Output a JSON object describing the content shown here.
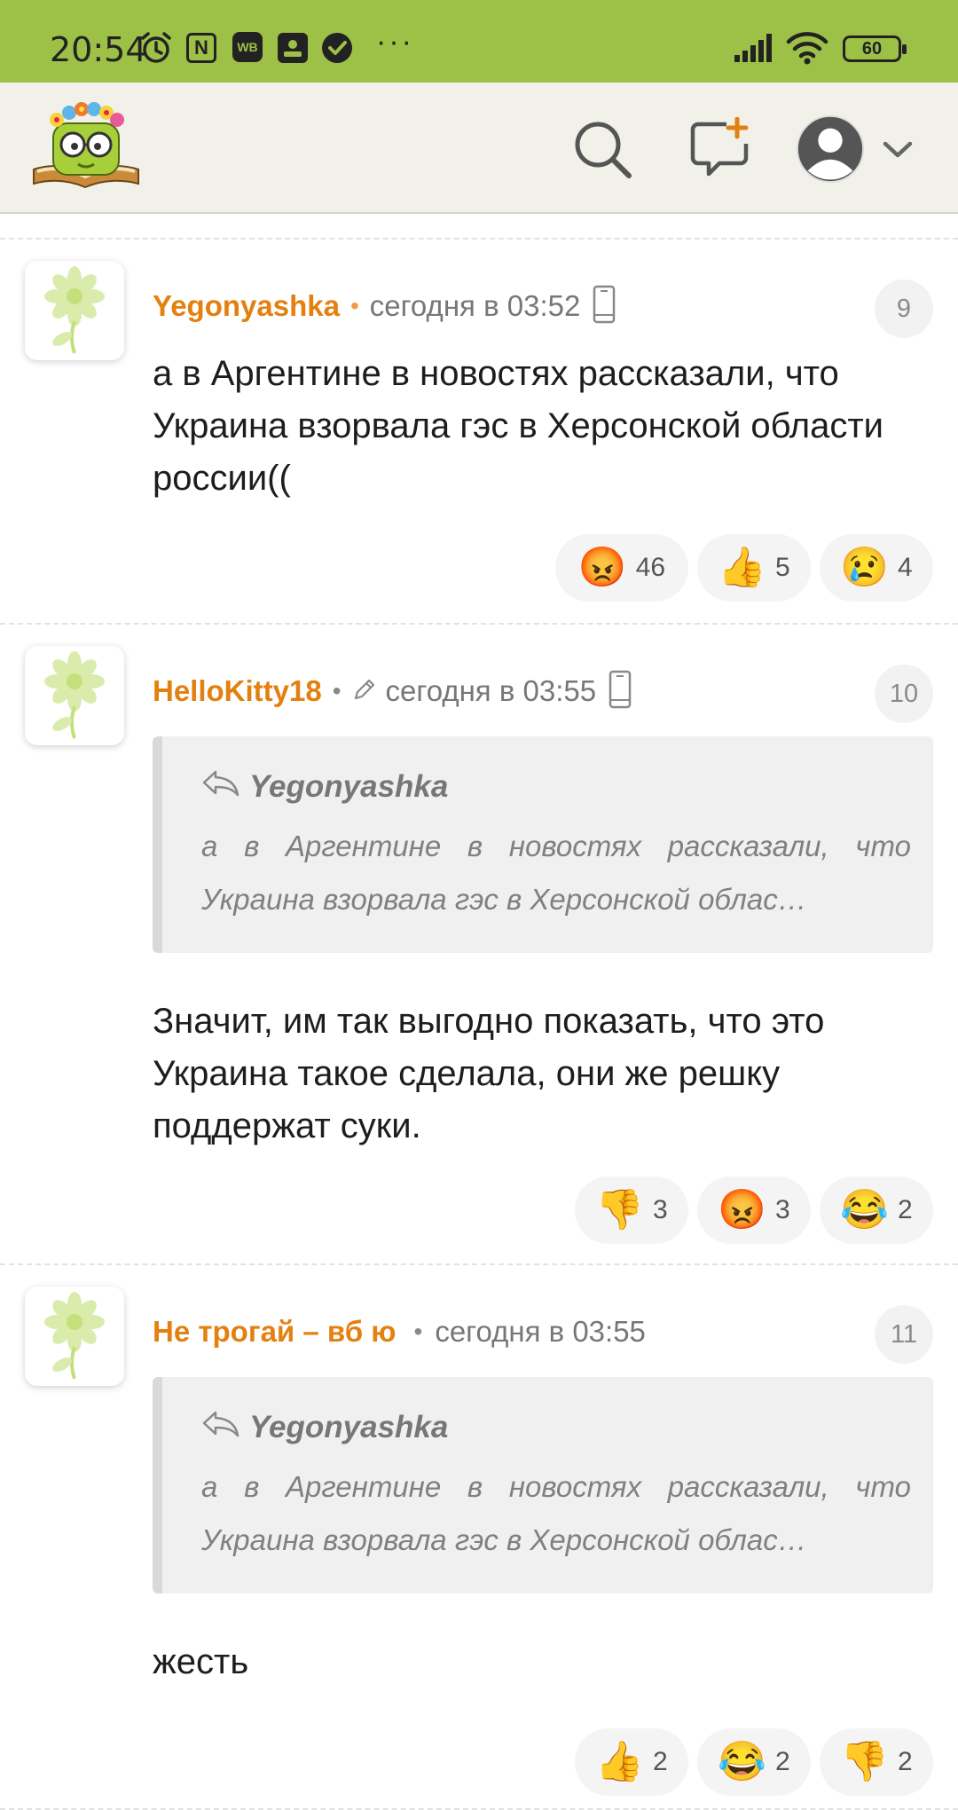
{
  "status_bar": {
    "time": "20:54",
    "wb_label": "WB",
    "nfc_label": "N",
    "battery": "60",
    "dots": "···"
  },
  "colors": {
    "status_bg": "#9dc147",
    "author": "#e3800f"
  },
  "comments": [
    {
      "author": "Yegonyashka",
      "timestamp": "сегодня в 03:52",
      "number": "9",
      "text": "а в Аргентине в новостях рассказали, что Украина взорвала гэс в Херсонской области россии((",
      "reactions": [
        {
          "emoji": "😡",
          "count": "46"
        },
        {
          "emoji": "👍",
          "count": "5"
        },
        {
          "emoji": "😢",
          "count": "4"
        }
      ]
    },
    {
      "author": "HelloKitty18",
      "timestamp": "сегодня в 03:55",
      "number": "10",
      "quote": {
        "author": "Yegonyashka",
        "text": "а в Аргентине в новостях рассказали, что Украина взорвала гэс в Херсонской облас…"
      },
      "text": "Значит, им так выгодно показать, что это Украина такое сделала, они же решку поддержат суки.",
      "reactions": [
        {
          "emoji": "👎",
          "count": "3"
        },
        {
          "emoji": "😡",
          "count": "3"
        },
        {
          "emoji": "😂",
          "count": "2"
        }
      ]
    },
    {
      "author": "Не трогай – вб ю",
      "timestamp": "сегодня в 03:55",
      "number": "11",
      "quote": {
        "author": "Yegonyashka",
        "text": "а в Аргентине в новостях рассказали, что Украина взорвала гэс в Херсонской облас…"
      },
      "text": "жесть",
      "reactions": [
        {
          "emoji": "👍",
          "count": "2"
        },
        {
          "emoji": "😂",
          "count": "2"
        },
        {
          "emoji": "👎",
          "count": "2"
        }
      ]
    }
  ]
}
